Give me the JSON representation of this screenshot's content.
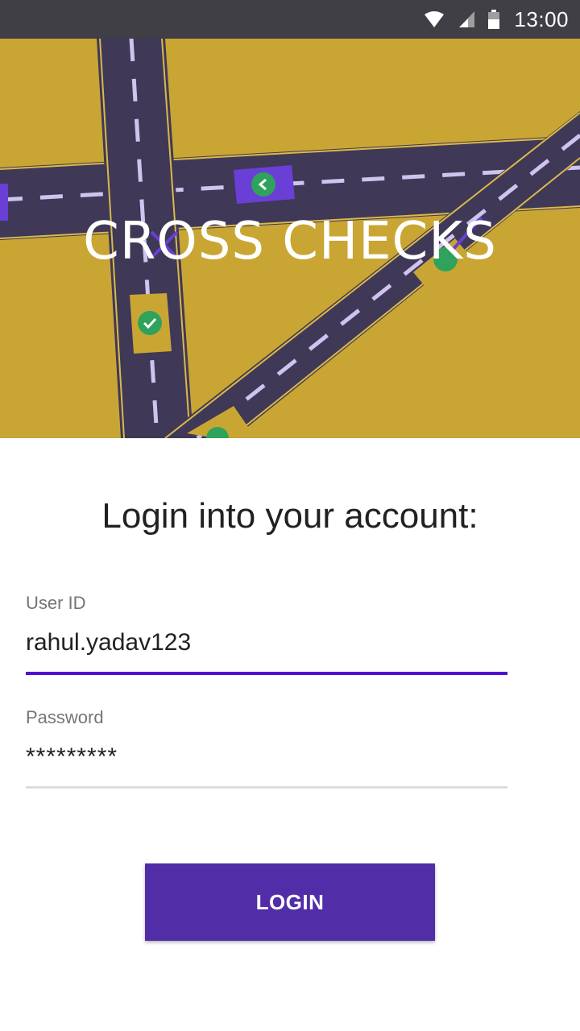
{
  "status_bar": {
    "time": "13:00",
    "icons": [
      "wifi-icon",
      "cell-signal-icon",
      "battery-icon"
    ]
  },
  "banner": {
    "app_title": "CROSS CHECKS",
    "colors": {
      "background": "#c9a634",
      "road": "#3f3857",
      "lane": "#cfc3ef",
      "accent": "#6a3fd6",
      "check": "#2fa35c"
    }
  },
  "login": {
    "heading": "Login into your account:",
    "user_id": {
      "label": "User ID",
      "value": "rahul.yadav123"
    },
    "password": {
      "label": "Password",
      "value": "*********"
    },
    "button_label": "LOGIN"
  },
  "colors": {
    "primary": "#512da8",
    "focus_underline": "#4f10d4"
  }
}
